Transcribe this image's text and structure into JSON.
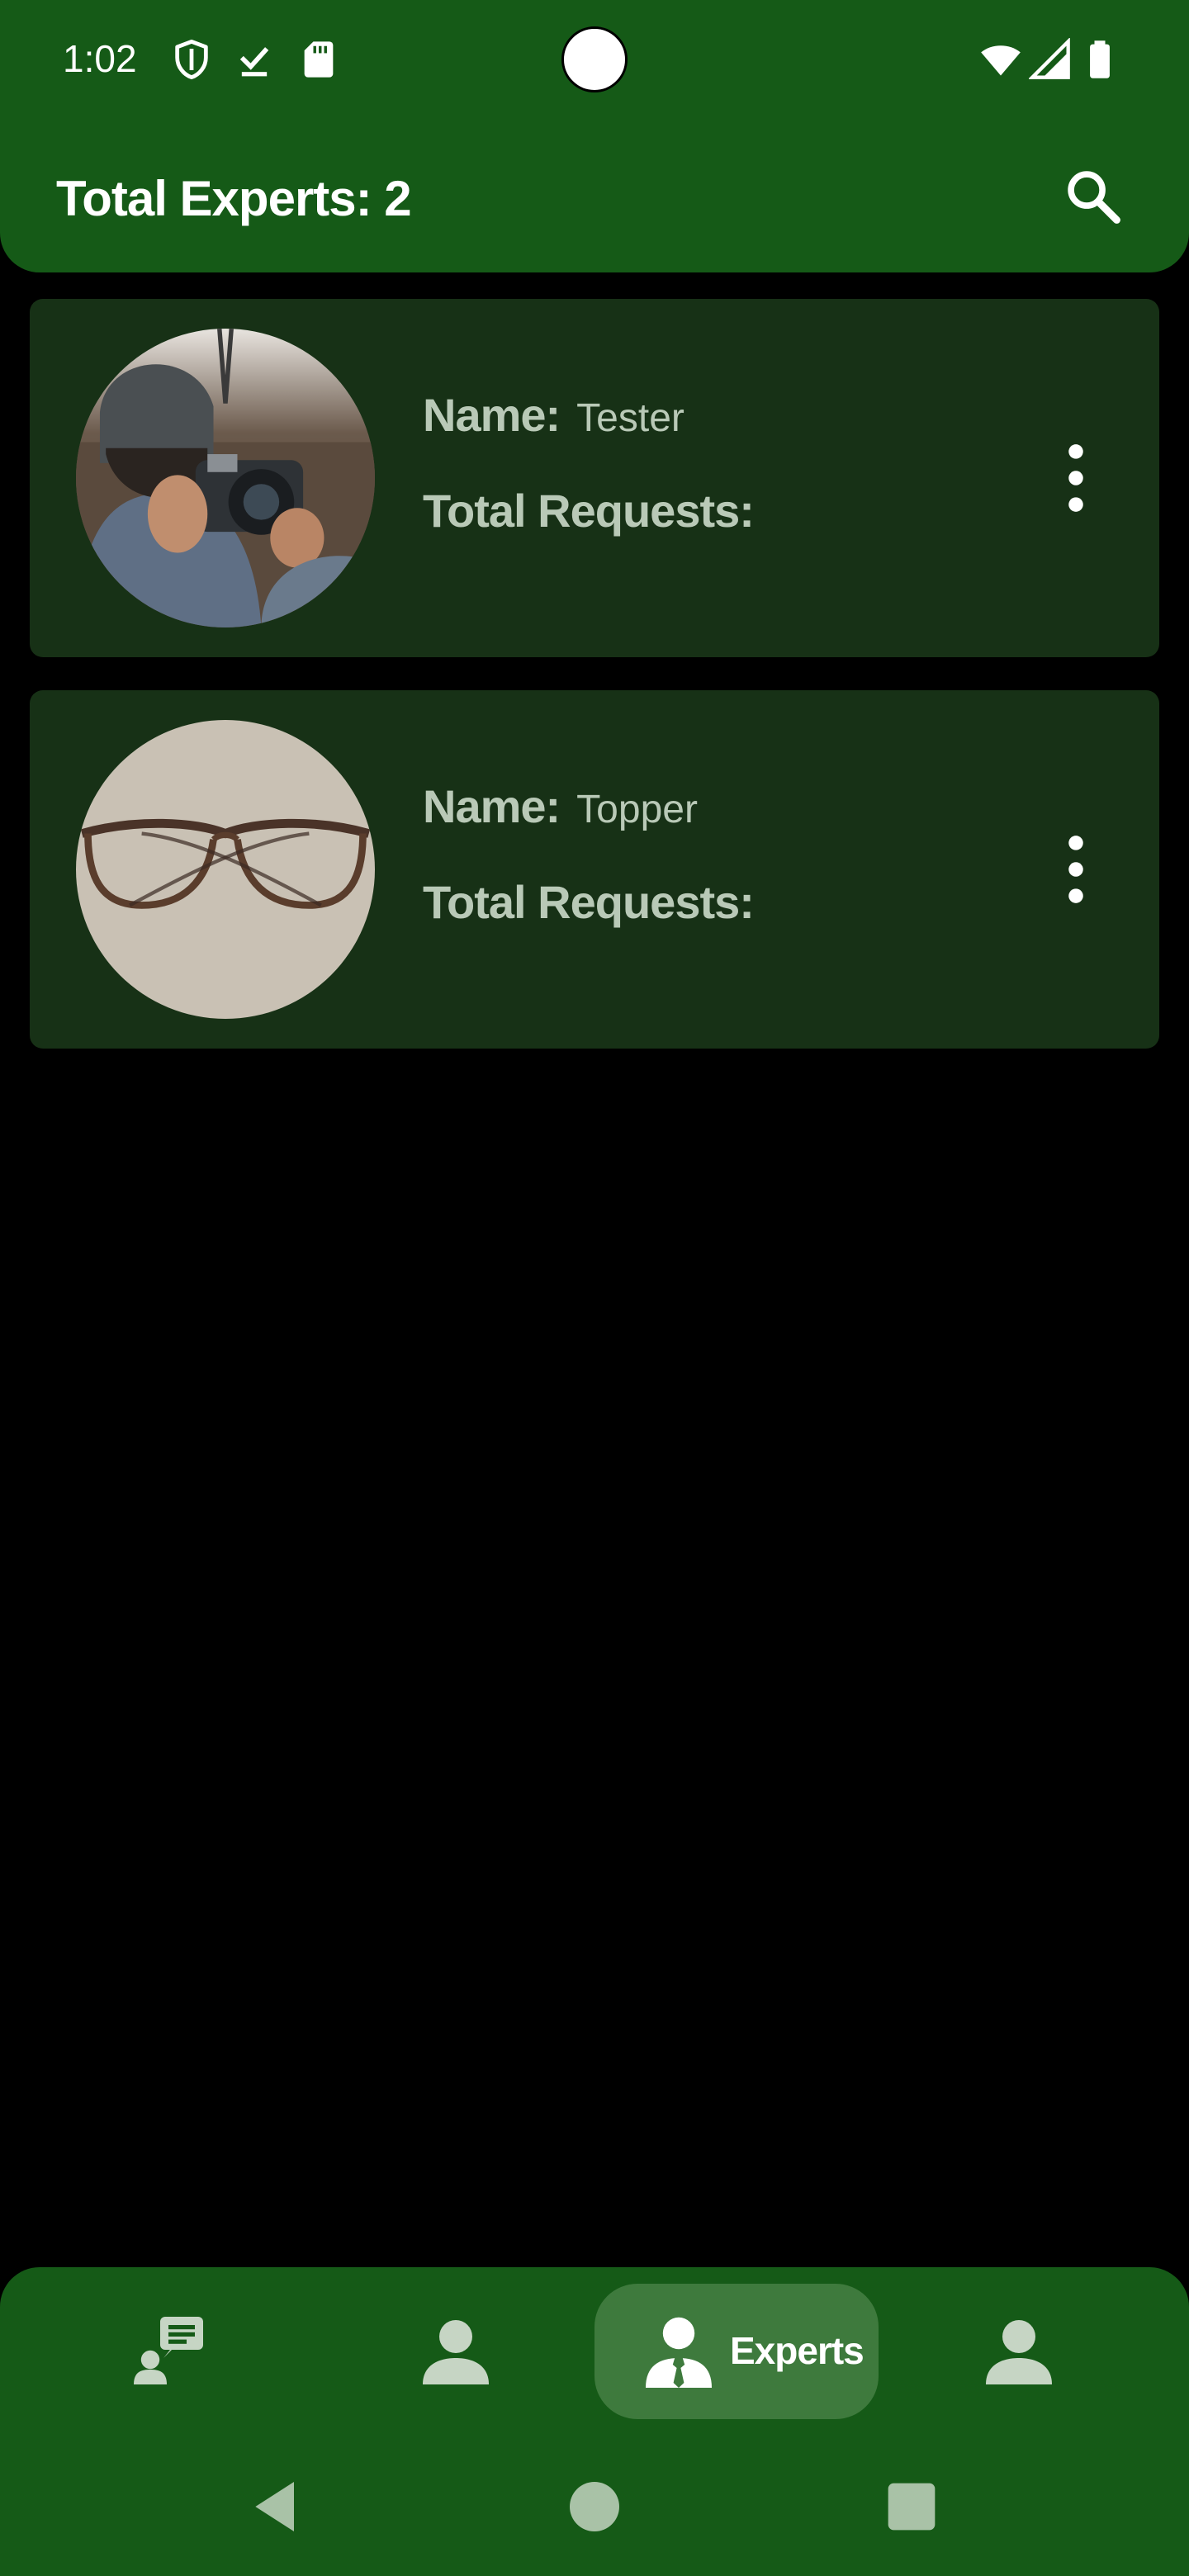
{
  "status_bar": {
    "time": "1:02",
    "icons": [
      "shield-icon",
      "download-done-icon",
      "sd-card-icon",
      "wifi-icon",
      "signal-icon",
      "battery-icon"
    ]
  },
  "appbar": {
    "title": "Total Experts: 2",
    "search_icon": "search-icon"
  },
  "experts": [
    {
      "name_label": "Name:",
      "name": "Tester",
      "requests_label": "Total Requests:",
      "requests": "",
      "avatar": "photographer-with-camera"
    },
    {
      "name_label": "Name:",
      "name": "Topper",
      "requests_label": "Total Requests:",
      "requests": "",
      "avatar": "eyeglasses"
    }
  ],
  "bottom_nav": {
    "items": [
      {
        "icon": "chat-user-icon",
        "label": ""
      },
      {
        "icon": "person-icon",
        "label": ""
      },
      {
        "icon": "expert-icon",
        "label": "Experts",
        "active": true
      },
      {
        "icon": "person-icon",
        "label": ""
      }
    ]
  },
  "system_nav": [
    "back-icon",
    "home-icon",
    "recents-icon"
  ],
  "colors": {
    "primary": "#155a17",
    "card": "#173116",
    "active_pill": "#3e7a3d",
    "card_text": "#b9c9b7",
    "background": "#000000"
  }
}
